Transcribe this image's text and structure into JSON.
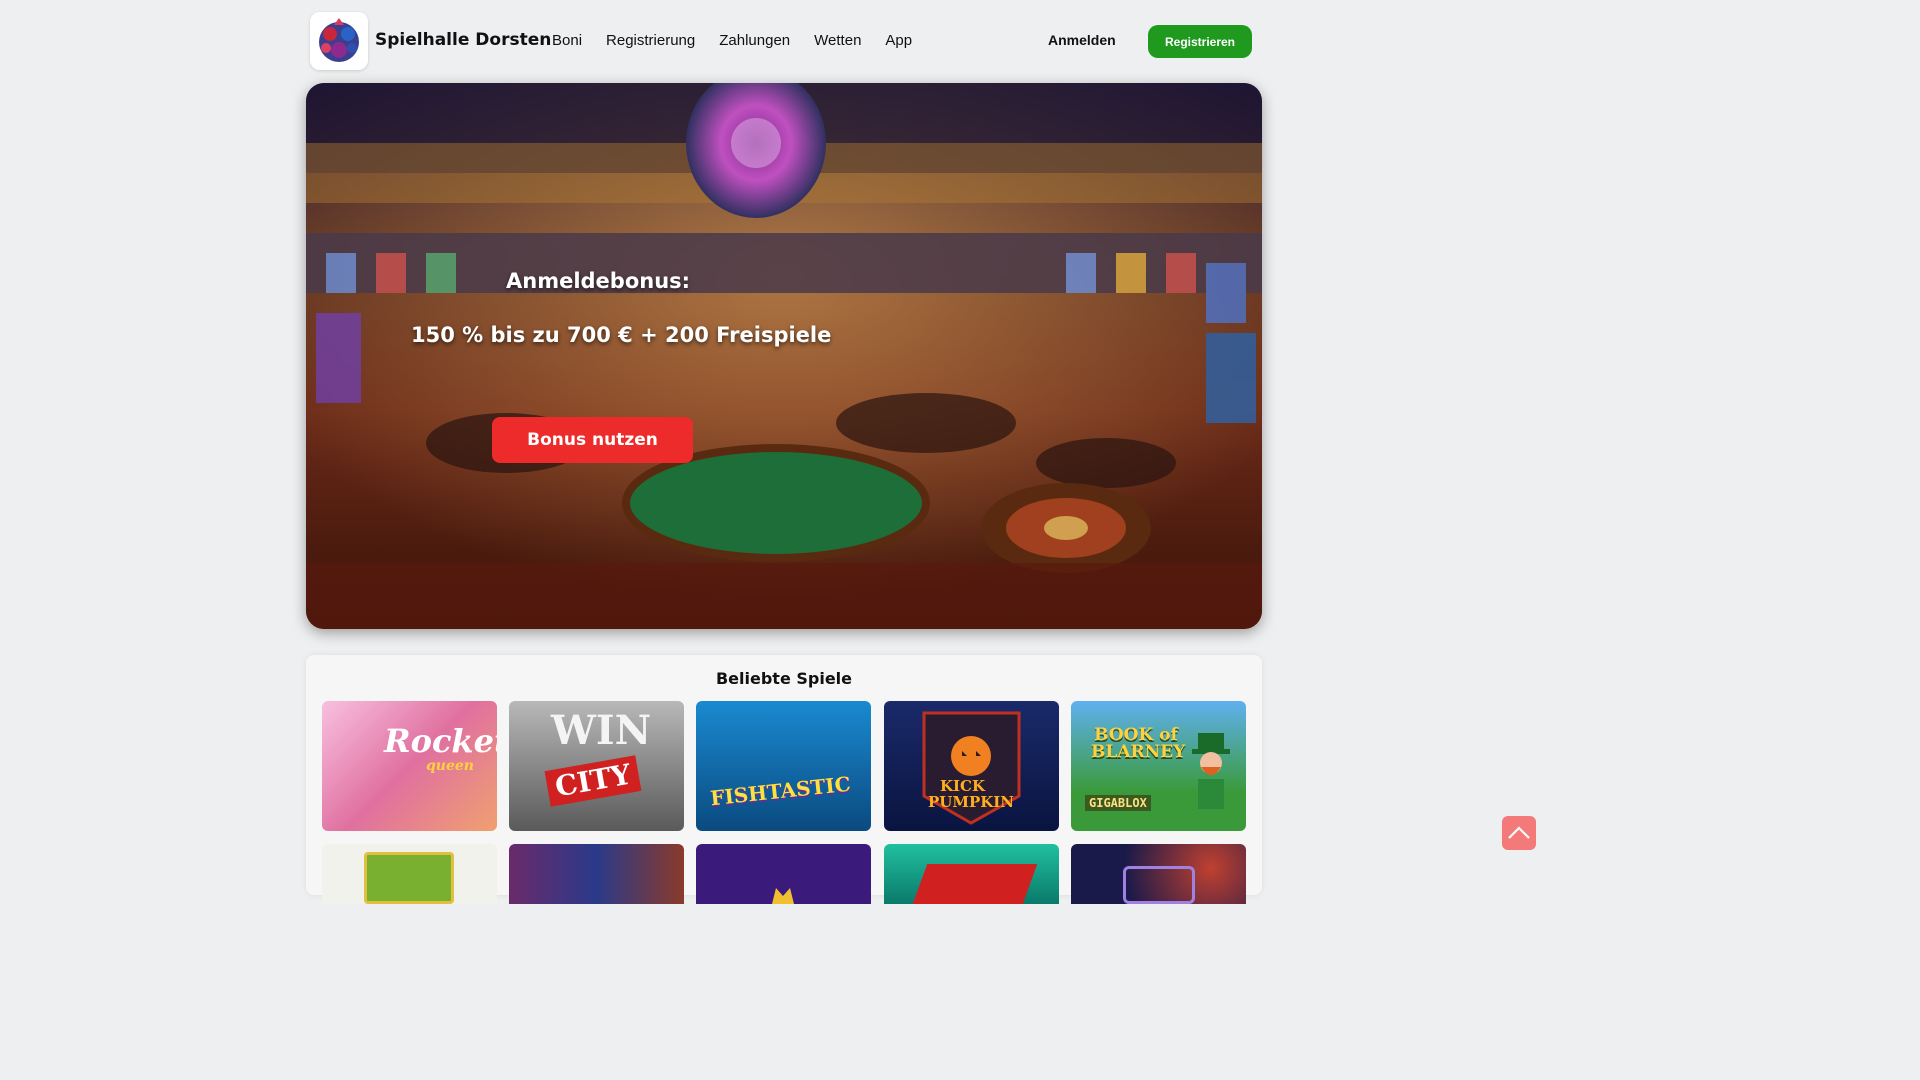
{
  "header": {
    "brand": "Spielhalle Dorsten",
    "nav": [
      "Boni",
      "Registrierung",
      "Zahlungen",
      "Wetten",
      "App"
    ],
    "login_label": "Anmelden",
    "register_label": "Registrieren"
  },
  "hero": {
    "title": "Anmeldebonus:",
    "offer": "150 % bis zu 700 € + 200 Freispiele",
    "cta_label": "Bonus nutzen"
  },
  "games": {
    "heading": "Beliebte Spiele",
    "tiles": [
      {
        "title": "Rocket",
        "subtitle": "queen"
      },
      {
        "title": "WIN",
        "subtitle": "CITY"
      },
      {
        "title": "FISHTASTIC",
        "subtitle": ""
      },
      {
        "title": "KICK",
        "subtitle": "PUMPKIN"
      },
      {
        "title": "BOOK of BLARNEY",
        "subtitle": "GIGABLOX"
      }
    ]
  },
  "colors": {
    "accent_green": "#1f9a1f",
    "cta_red": "#ee2b2b",
    "scroll_top": "#f47a7a"
  },
  "icons": {
    "logo": "casino-logo-icon",
    "scroll_top": "chevron-up-icon"
  }
}
